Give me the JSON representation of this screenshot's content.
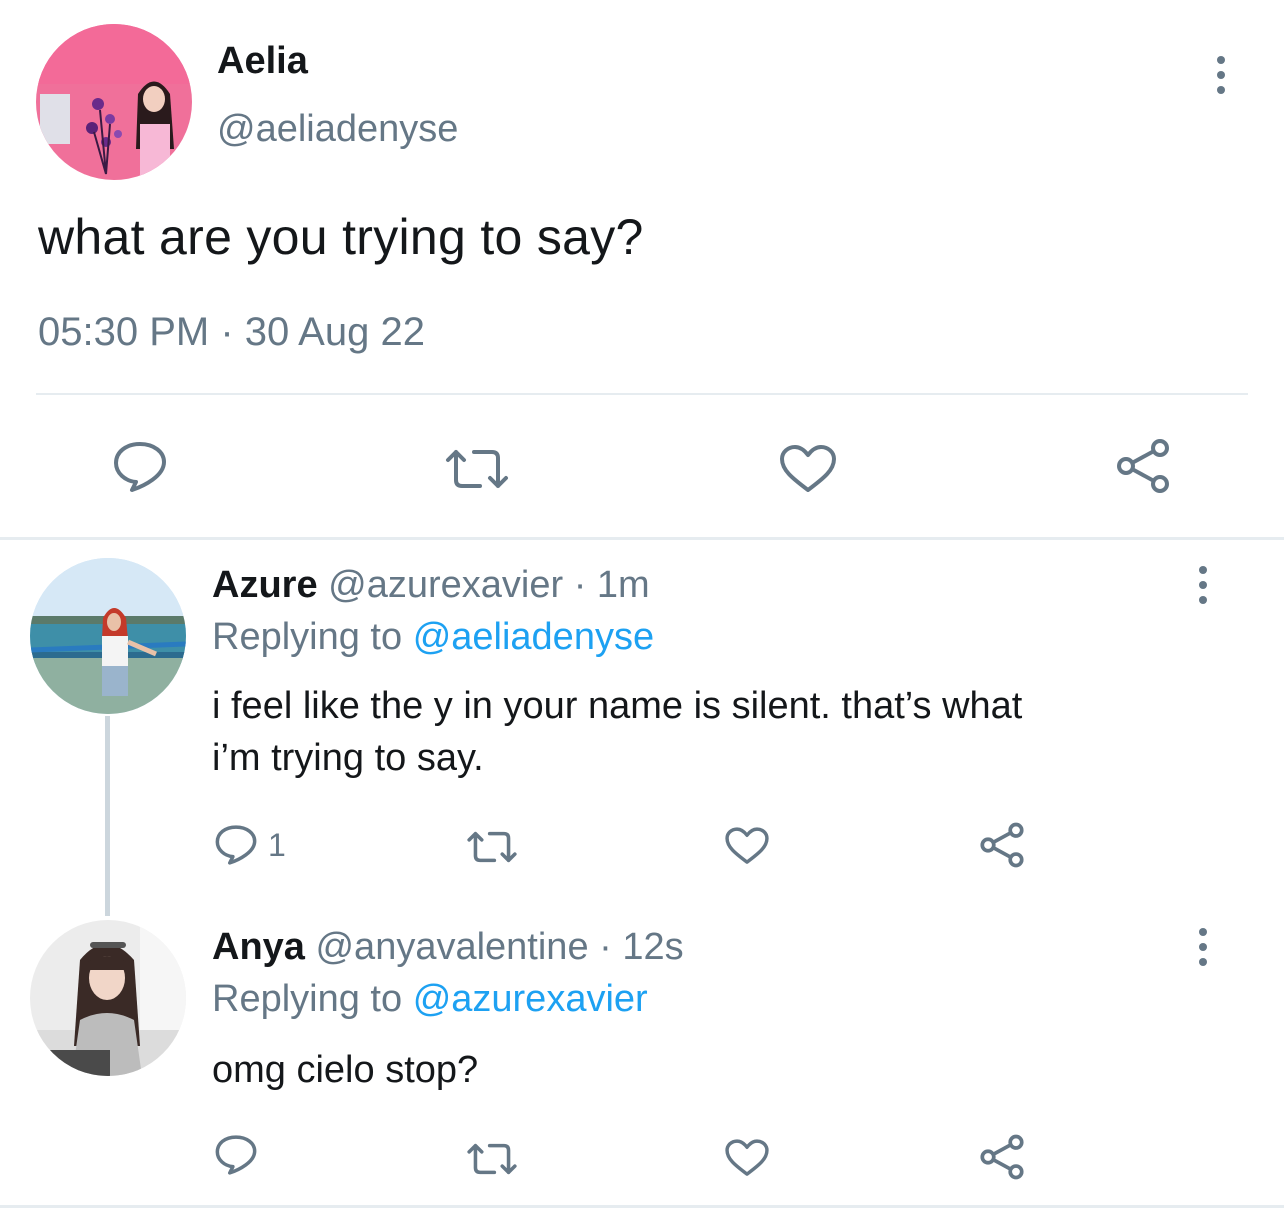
{
  "main_tweet": {
    "name": "Aelia",
    "handle": "@aeliadenyse",
    "text": "what are you trying to say?",
    "timestamp": "05:30 PM · 30 Aug 22",
    "actions": [
      "reply-icon",
      "retweet-icon",
      "like-icon",
      "share-icon"
    ]
  },
  "replies": [
    {
      "name": "Azure",
      "handle_time": "@azurexavier · 1m",
      "replying_prefix": "Replying to",
      "replying_to": "@aeliadenyse",
      "text_line1": "i feel like the y in your name is silent. that’s what",
      "text_line2": "i’m trying to say.",
      "reply_count": "1"
    },
    {
      "name": "Anya",
      "handle_time": "@anyavalentine · 12s",
      "replying_prefix": "Replying to",
      "replying_to": "@azurexavier",
      "text_line1": "omg cielo stop?",
      "reply_count": ""
    }
  ],
  "colors": {
    "text": "#14171a",
    "secondary": "#657786",
    "mention": "#1da1f2",
    "divider": "#e6ecf0",
    "thread_line": "#ccd6dd"
  }
}
